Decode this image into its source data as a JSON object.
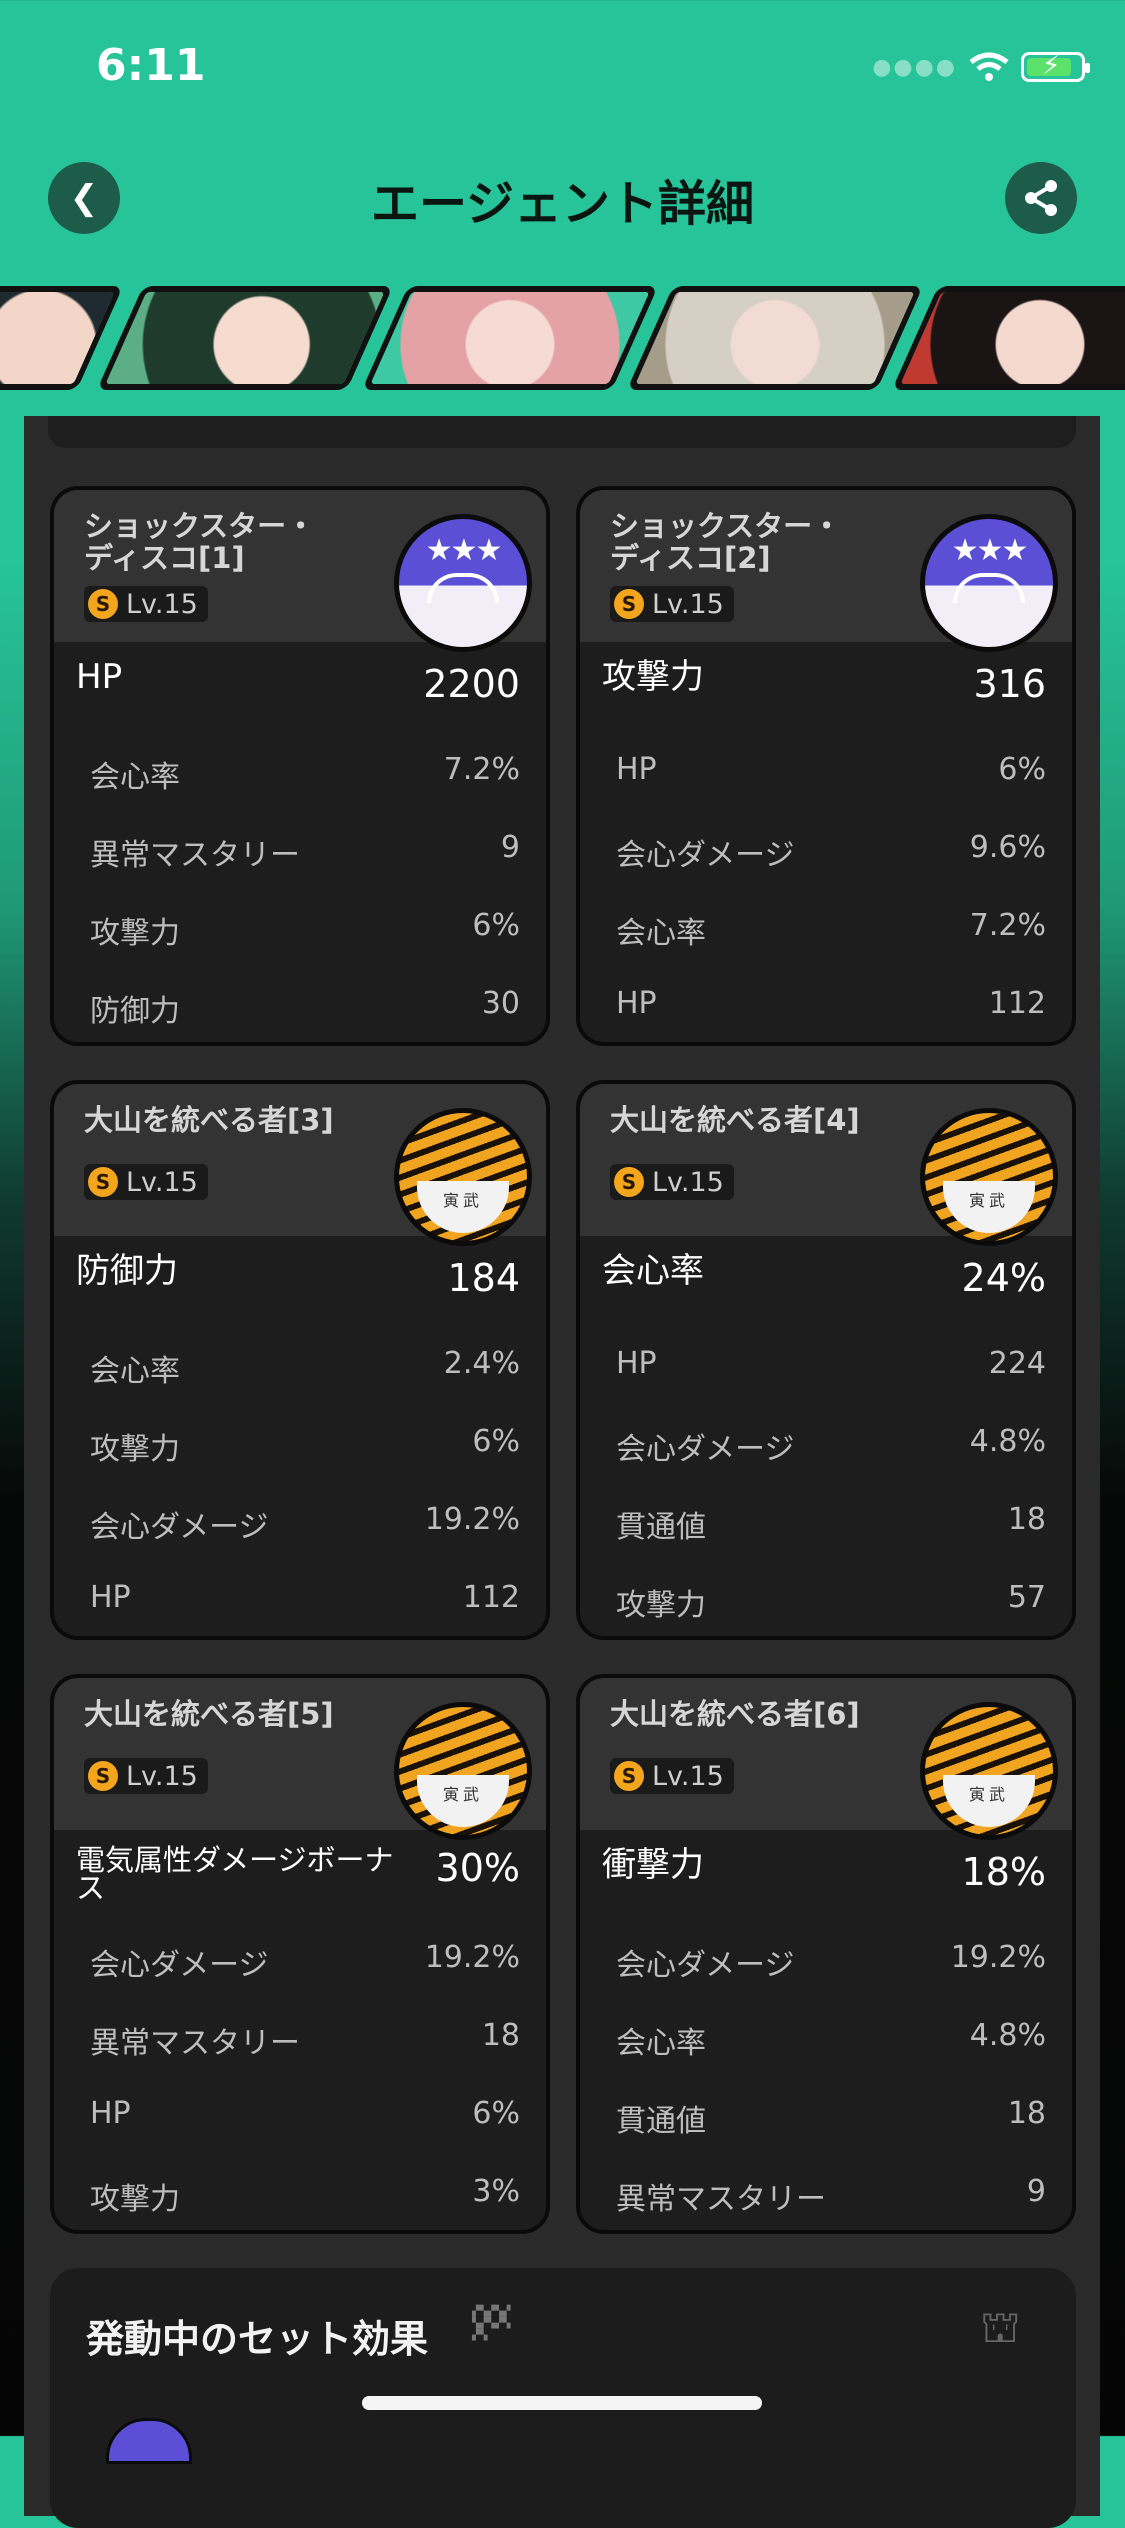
{
  "status": {
    "time": "6:11"
  },
  "header": {
    "title": "エージェント詳細"
  },
  "icons": {
    "back": "chevron-left-icon",
    "share": "share-icon",
    "wifi": "wifi-icon",
    "battery": "battery-charging-icon"
  },
  "colors": {
    "accent": "#27c499",
    "highlight": "#f1e04a",
    "card_bg": "#1d1d1d"
  },
  "discs": [
    {
      "name": "ショックスター・ディスコ[1]",
      "level": "Lv.15",
      "main": {
        "label": "HP",
        "value": "2200"
      },
      "subs": [
        {
          "label": "会心率",
          "value": "7.2%"
        },
        {
          "label": "異常マスタリー",
          "value": "9"
        },
        {
          "label": "攻撃力",
          "value": "6%"
        },
        {
          "label": "防御力",
          "value": "30"
        }
      ]
    },
    {
      "name": "ショックスター・ディスコ[2]",
      "level": "Lv.15",
      "main": {
        "label": "攻撃力",
        "value": "316"
      },
      "subs": [
        {
          "label": "HP",
          "value": "6%"
        },
        {
          "label": "会心ダメージ",
          "value": "9.6%"
        },
        {
          "label": "会心率",
          "value": "7.2%"
        },
        {
          "label": "HP",
          "value": "112"
        }
      ]
    },
    {
      "name": "大山を統べる者[3]",
      "level": "Lv.15",
      "main": {
        "label": "防御力",
        "value": "184"
      },
      "subs": [
        {
          "label": "会心率",
          "value": "2.4%"
        },
        {
          "label": "攻撃力",
          "value": "6%"
        },
        {
          "label": "会心ダメージ",
          "value": "19.2%"
        },
        {
          "label": "HP",
          "value": "112"
        }
      ]
    },
    {
      "name": "大山を統べる者[4]",
      "level": "Lv.15",
      "main": {
        "label": "会心率",
        "value": "24%"
      },
      "subs": [
        {
          "label": "HP",
          "value": "224"
        },
        {
          "label": "会心ダメージ",
          "value": "4.8%"
        },
        {
          "label": "貫通値",
          "value": "18"
        },
        {
          "label": "攻撃力",
          "value": "57"
        }
      ]
    },
    {
      "name": "大山を統べる者[5]",
      "level": "Lv.15",
      "main": {
        "label": "電気属性ダメージボーナス",
        "value": "30%"
      },
      "subs": [
        {
          "label": "会心ダメージ",
          "value": "19.2%"
        },
        {
          "label": "異常マスタリー",
          "value": "18"
        },
        {
          "label": "HP",
          "value": "6%"
        },
        {
          "label": "攻撃力",
          "value": "3%"
        }
      ]
    },
    {
      "name": "大山を統べる者[6]",
      "level": "Lv.15",
      "main": {
        "label": "衝撃力",
        "value": "18%"
      },
      "subs": [
        {
          "label": "会心ダメージ",
          "value": "19.2%"
        },
        {
          "label": "会心率",
          "value": "4.8%"
        },
        {
          "label": "貫通値",
          "value": "18"
        },
        {
          "label": "異常マスタリー",
          "value": "9"
        }
      ]
    }
  ],
  "set_effects": {
    "title": "発動中のセット効果"
  }
}
